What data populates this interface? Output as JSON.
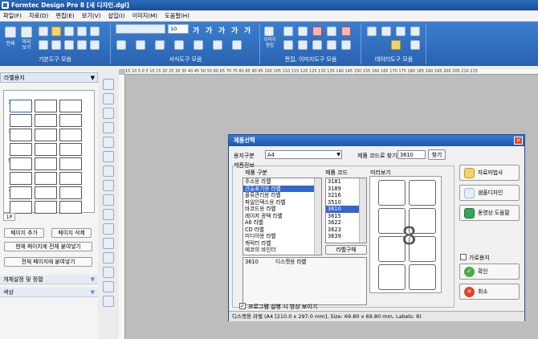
{
  "window": {
    "title": "Formtec Design Pro 8 [새 디자인.dgl]"
  },
  "menu": [
    "파일(F)",
    "자료(D)",
    "편집(E)",
    "보기(V)",
    "삽입(I)",
    "이미지(M)",
    "도움말(H)"
  ],
  "ribbon": {
    "groups": [
      "기본도구 모음",
      "서식도구 모음",
      "편집, 이미지도구 모음",
      "데이터도구 모음"
    ],
    "print_label": "인쇄",
    "preview_label": "미리\n보기",
    "font_size": "10",
    "image_edit_label": "이미지\n편집",
    "text_style_glyphs": [
      "가",
      "가",
      "가",
      "가",
      "가"
    ]
  },
  "left_panel": {
    "header": "라벨용지",
    "page_numbers": [
      "1",
      "3",
      "5",
      "7"
    ],
    "page_tab": "1P",
    "buttons": {
      "add_page": "페이지 추가",
      "delete_page": "페이지 삭제",
      "paste_current": "현재 페이지에 전체 붙여넣기",
      "paste_all": "전체 페이지에 붙여넣기"
    },
    "sections": [
      "개체설정 및 정렬",
      "색상"
    ]
  },
  "dialog": {
    "title": "제품선택",
    "paper_label": "용지구분",
    "paper_value": "A4",
    "code_search_label": "제품 코드로 찾기",
    "code_search_value": "3610",
    "search_button": "찾기",
    "product_info_label": "제품정보",
    "category_header": "제품 구분",
    "code_header": "제품 코드",
    "preview_header": "미리보기",
    "categories": [
      "주소용 라벨",
      "견출표기용 라벨",
      "물류관리용 라벨",
      "파일인덱스용 라벨",
      "바코드용 라벨",
      "레이저 광택 라벨",
      "A6 라벨",
      "CD 라벨",
      "미디어용 라벨",
      "캐릭터 라벨",
      "에코의 바인더"
    ],
    "selected_category_index": 1,
    "codes": [
      "3181",
      "3189",
      "3216",
      "3510",
      "3610",
      "3615",
      "3622",
      "3623",
      "3639"
    ],
    "selected_code_index": 4,
    "label_shape_button": "라벨구매",
    "detail_code": "3610",
    "detail_name": "디스켓용 라벨",
    "preview_number": "8",
    "buttons": {
      "data_wizard": "자료마법사",
      "sample_design": "샘플디자인",
      "video_help": "동영상 도움말",
      "ok": "확인",
      "cancel": "취소"
    },
    "landscape_label": "가로용지",
    "show_on_start_label": "프로그램 실행 시 항상 보이기",
    "status": "디스켓용 라벨 (A4 [210.0 x 297.0 mm], Size: 69.80 x 69.80 mm, Labels: 8)"
  },
  "ruler_text": "15  10  5  0  5  10  15  20  25  30  35  40  45  50  55  60  65  70  75  80  85  90  95  100  105  110  115  120  125  130  135  140  145  150  155  160  165  170  175  180  185  190  195  200  205  210  215"
}
